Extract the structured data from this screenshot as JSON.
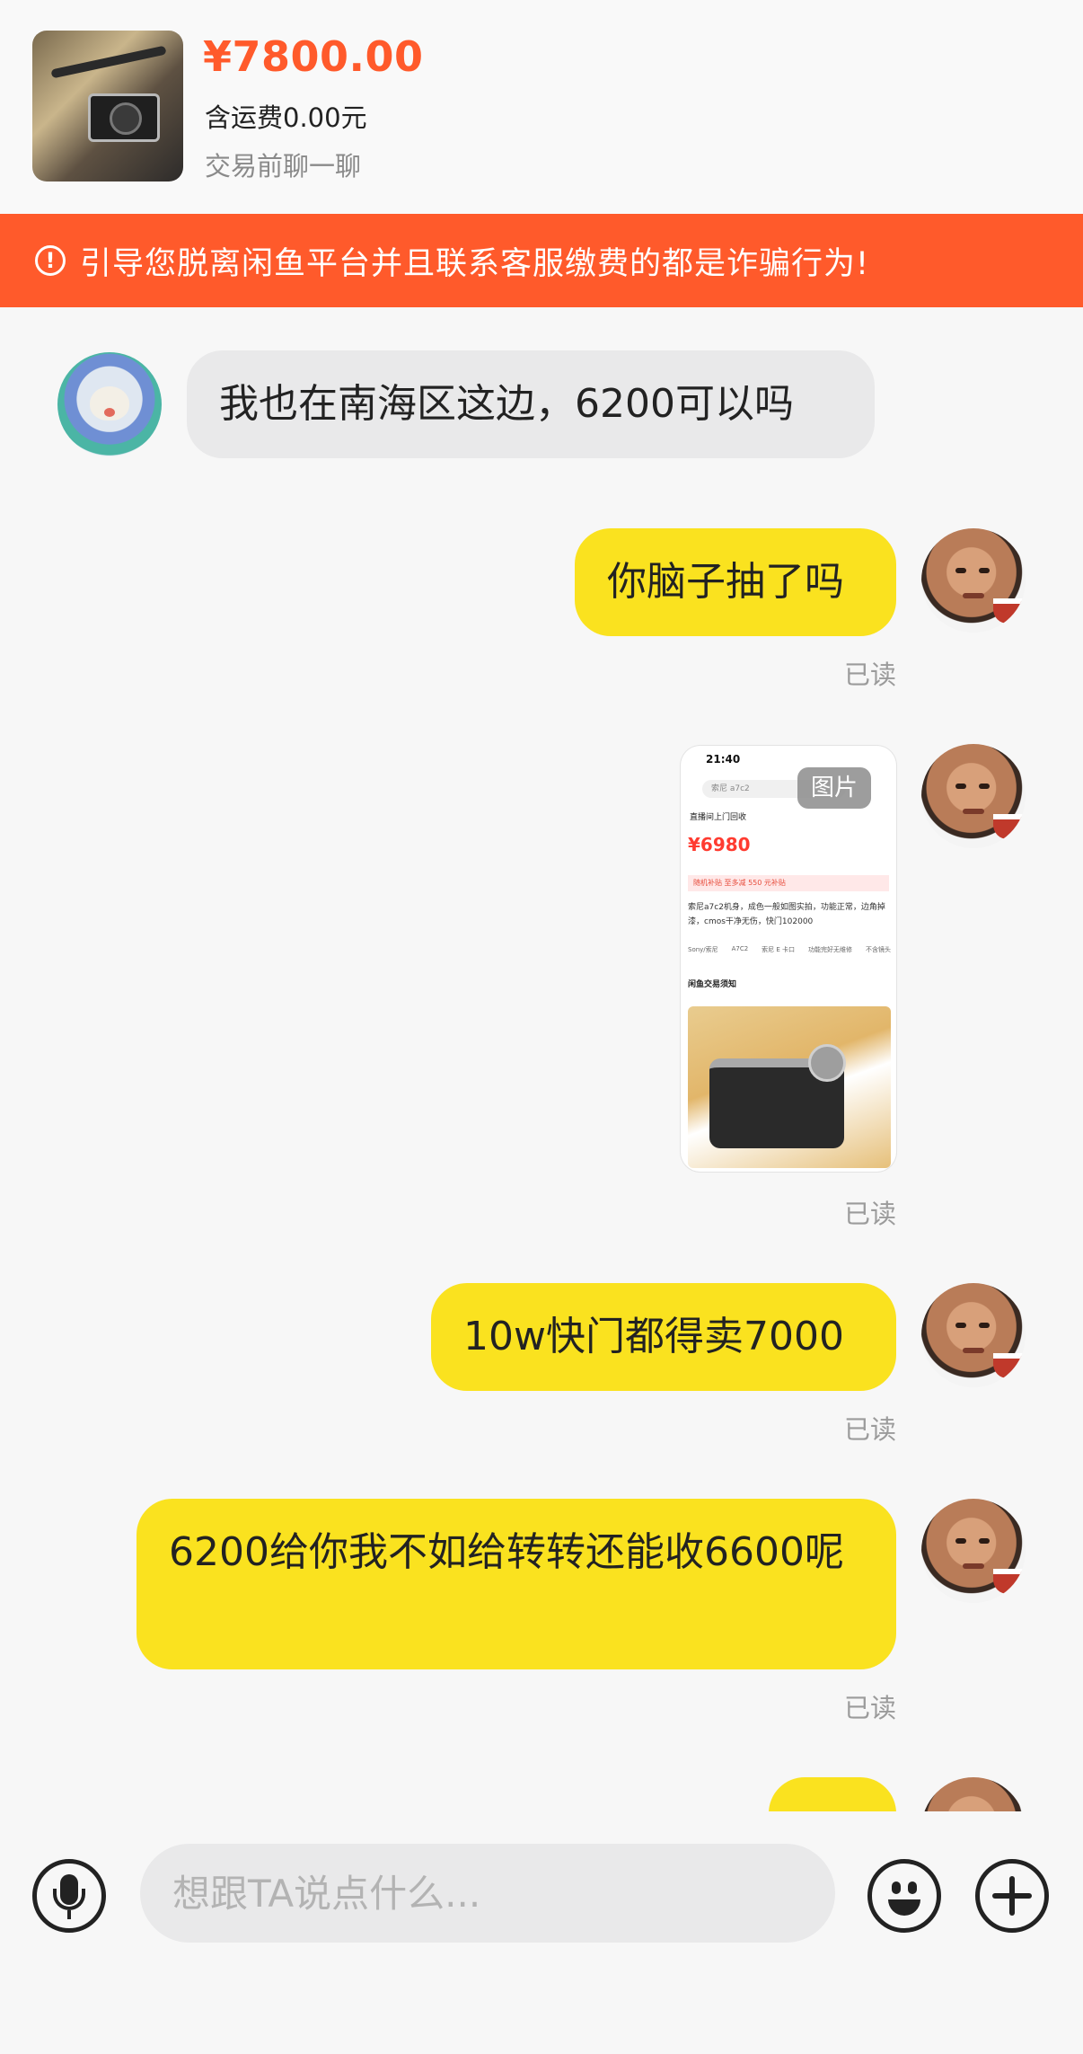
{
  "product": {
    "price": "¥7800.00",
    "shipping": "含运费0.00元",
    "chat_tip": "交易前聊一聊"
  },
  "warning_banner": {
    "icon": "alert-circle-icon",
    "text": "引导您脱离闲鱼平台并且联系客服缴费的都是诈骗行为!"
  },
  "messages": [
    {
      "from": "other",
      "text": "我也在南海区这边，6200可以吗"
    },
    {
      "from": "me",
      "text": "你脑子抽了吗",
      "status": "已读"
    },
    {
      "from": "me",
      "type": "image",
      "status": "已读",
      "image": {
        "tag": "图片",
        "status_time": "21:40",
        "search_text": "索尼 a7c2",
        "seller": "直播间上门回收",
        "price": "¥6980",
        "promo": "随机补贴 至多减 550 元补贴",
        "desc": "索尼a7c2机身，成色一般如图实拍，功能正常，边角掉漆，cmos干净无伤，快门102000",
        "specs": [
          "Sony/索尼",
          "A7C2",
          "索尼 E 卡口",
          "功能完好无维修",
          "不含镜头"
        ],
        "notice": "闲鱼交易须知"
      }
    },
    {
      "from": "me",
      "text": "10w快门都得卖7000",
      "status": "已读"
    },
    {
      "from": "me",
      "text": "6200给你我不如给转转还能收6600呢",
      "status": "已读"
    }
  ],
  "input": {
    "placeholder": "想跟TA说点什么...",
    "mic_icon": "microphone-icon",
    "emoji_icon": "emoji-icon",
    "plus_icon": "plus-icon"
  },
  "colors": {
    "accent": "#ff5a2b",
    "out_bubble": "#fae21f",
    "in_bubble": "#e9e9ea"
  }
}
